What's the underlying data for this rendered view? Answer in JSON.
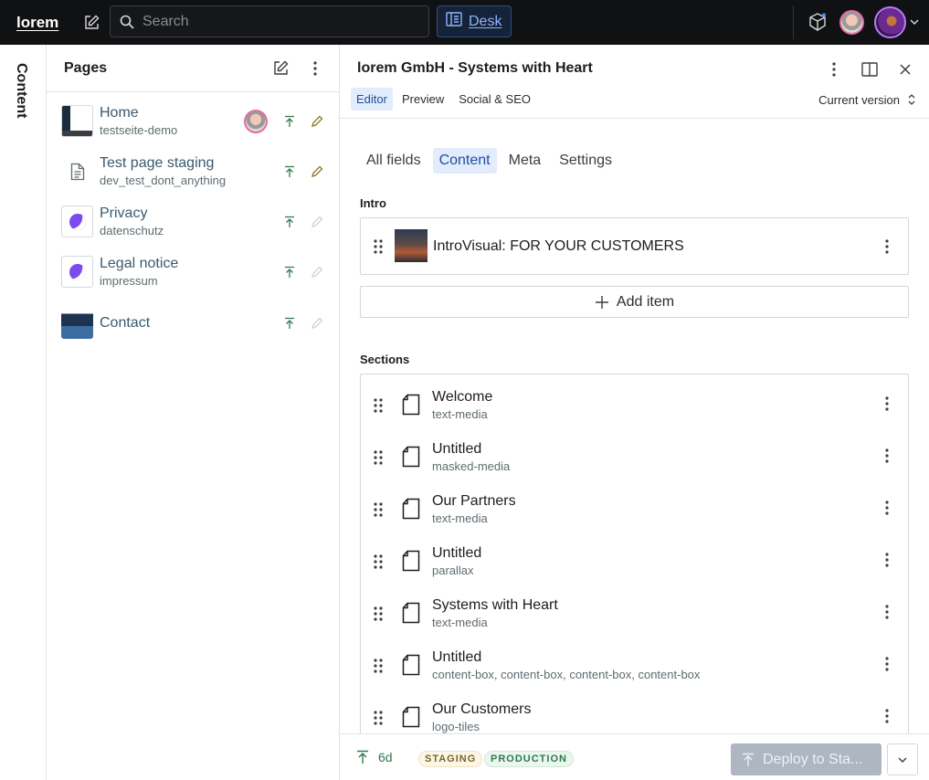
{
  "topbar": {
    "brand": "lorem",
    "search_placeholder": "Search",
    "desk_label": "Desk"
  },
  "sidebar_strip": {
    "label": "Content"
  },
  "pages": {
    "title": "Pages",
    "items": [
      {
        "title": "Home",
        "slug": "testseite-demo"
      },
      {
        "title": "Test page staging",
        "slug": "dev_test_dont_anything"
      },
      {
        "title": "Privacy",
        "slug": "datenschutz"
      },
      {
        "title": "Legal notice",
        "slug": "impressum"
      },
      {
        "title": "Contact",
        "slug": ""
      }
    ]
  },
  "editor": {
    "title": "lorem GmbH - Systems with Heart",
    "tabs": [
      "Editor",
      "Preview",
      "Social & SEO"
    ],
    "version": "Current version",
    "form_tabs": [
      "All fields",
      "Content",
      "Meta",
      "Settings"
    ],
    "intro_label": "Intro",
    "intro_item": "IntroVisual: FOR YOUR CUSTOMERS",
    "add_item": "Add item",
    "sections_label": "Sections",
    "sections": [
      {
        "title": "Welcome",
        "type": "text-media"
      },
      {
        "title": "Untitled",
        "type": "masked-media"
      },
      {
        "title": "Our Partners",
        "type": "text-media"
      },
      {
        "title": "Untitled",
        "type": "parallax"
      },
      {
        "title": "Systems with Heart",
        "type": "text-media"
      },
      {
        "title": "Untitled",
        "type": "content-box, content-box, content-box, content-box"
      },
      {
        "title": "Our Customers",
        "type": "logo-tiles"
      }
    ]
  },
  "footer": {
    "published_ago": "6d",
    "badge_staging": "STAGING",
    "badge_production": "PRODUCTION",
    "deploy_label": "Deploy to Sta..."
  },
  "colors": {
    "topbar_bg": "#101112",
    "accent_blue": "#1f4d9e",
    "published_green": "#2f7a4e"
  }
}
